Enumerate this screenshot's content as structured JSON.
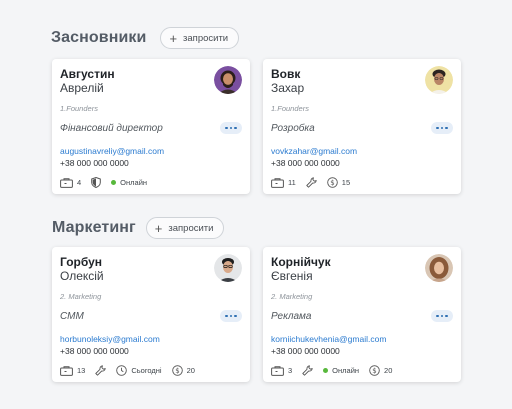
{
  "sections": [
    {
      "title": "Засновники",
      "invite_label": "запросити",
      "cards": [
        {
          "surname": "Августин",
          "firstname": "Аврелій",
          "department": "1.Founders",
          "position": "Фінансовий директор",
          "email": "augustinavreliy@gmail.com",
          "phone": "+38 000 000 0000",
          "tasks_count": "4",
          "status": "Онлайн"
        },
        {
          "surname": "Вовк",
          "firstname": "Захар",
          "department": "1.Founders",
          "position": "Розробка",
          "email": "vovkzahar@gmail.com",
          "phone": "+38 000 000 0000",
          "tasks_count": "11",
          "rate": "15"
        }
      ]
    },
    {
      "title": "Маркетинг",
      "invite_label": "запросити",
      "cards": [
        {
          "surname": "Горбун",
          "firstname": "Олексій",
          "department": "2. Marketing",
          "position": "СММ",
          "email": "horbunoleksiy@gmail.com",
          "phone": "+38 000 000 0000",
          "tasks_count": "13",
          "schedule": "Сьогодні",
          "rate": "20"
        },
        {
          "surname": "Корнійчук",
          "firstname": "Євгенія",
          "department": "2. Marketing",
          "position": "Реклама",
          "email": "korniichukevhenia@gmail.com",
          "phone": "+38 000 000 0000",
          "tasks_count": "3",
          "status": "Онлайн",
          "rate": "20"
        }
      ]
    }
  ],
  "colors": {
    "accent": "#2b7bd0",
    "online": "#58b83c",
    "background": "#f4f5f7"
  }
}
